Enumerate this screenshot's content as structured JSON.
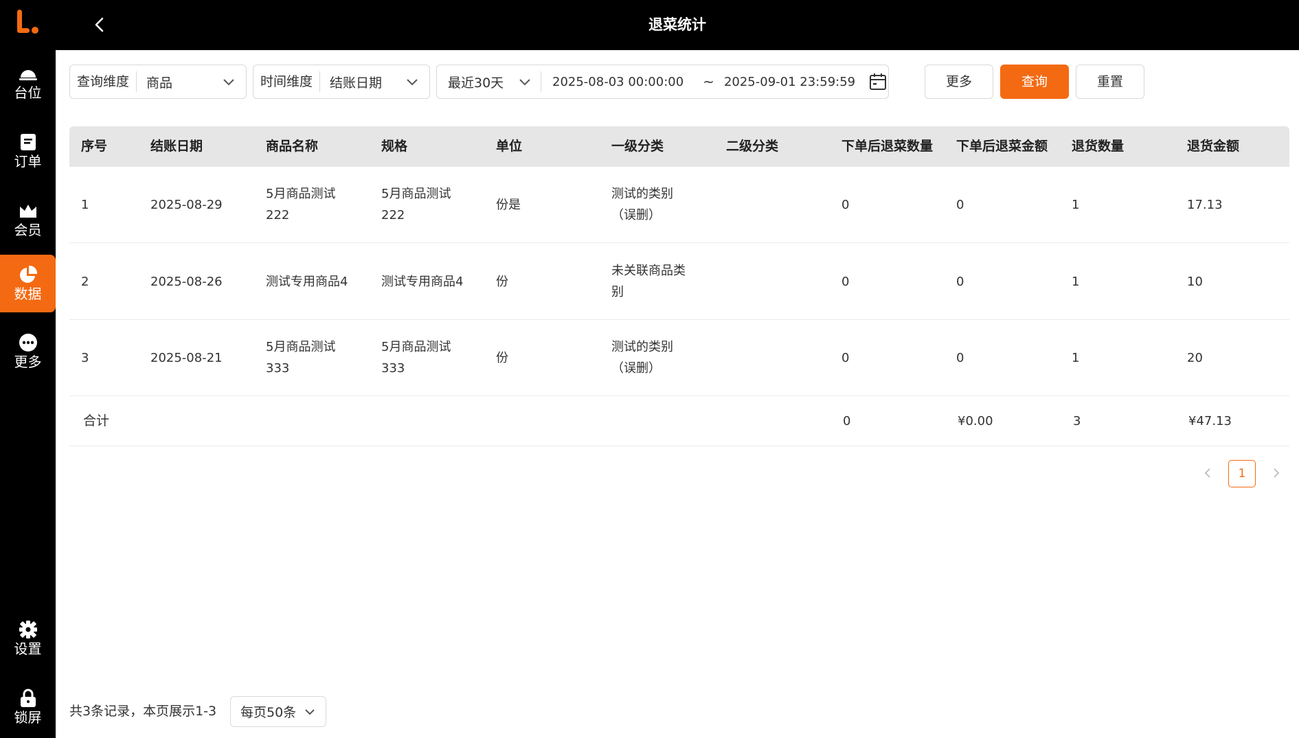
{
  "sidebar": {
    "items": [
      {
        "label": "台位",
        "icon": "table-bell-icon"
      },
      {
        "label": "订单",
        "icon": "order-doc-icon"
      },
      {
        "label": "会员",
        "icon": "crown-icon"
      },
      {
        "label": "数据",
        "icon": "pie-chart-icon",
        "active": true
      },
      {
        "label": "更多",
        "icon": "more-dots-icon"
      },
      {
        "label": "设置",
        "icon": "gear-icon"
      },
      {
        "label": "锁屏",
        "icon": "lock-icon"
      }
    ]
  },
  "header": {
    "title": "退菜统计"
  },
  "filters": {
    "query_dimension": {
      "label": "查询维度",
      "value": "商品"
    },
    "time_dimension": {
      "label": "时间维度",
      "value": "结账日期"
    },
    "range": {
      "preset": "最近30天",
      "start": "2025-08-03 00:00:00",
      "separator": "~",
      "end": "2025-09-01 23:59:59"
    }
  },
  "buttons": {
    "more": "更多",
    "query": "查询",
    "reset": "重置"
  },
  "table": {
    "columns": [
      "序号",
      "结账日期",
      "商品名称",
      "规格",
      "单位",
      "一级分类",
      "二级分类",
      "下单后退菜数量",
      "下单后退菜金额",
      "退货数量",
      "退货金额"
    ],
    "rows": [
      {
        "no": "1",
        "date": "2025-08-29",
        "name1": "5月商品测试",
        "name2": "222",
        "spec1": "5月商品测试",
        "spec2": "222",
        "unit": "份是",
        "cat1a": "测试的类别",
        "cat1b": "（误删）",
        "cat2": "",
        "ret_qty": "0",
        "ret_amt": "0",
        "refund_qty": "1",
        "refund_amt": "17.13"
      },
      {
        "no": "2",
        "date": "2025-08-26",
        "name1": "测试专用商品4",
        "name2": "",
        "spec1": "测试专用商品4",
        "spec2": "",
        "unit": "份",
        "cat1a": "未关联商品类",
        "cat1b": "别",
        "cat2": "",
        "ret_qty": "0",
        "ret_amt": "0",
        "refund_qty": "1",
        "refund_amt": "10"
      },
      {
        "no": "3",
        "date": "2025-08-21",
        "name1": "5月商品测试",
        "name2": "333",
        "spec1": "5月商品测试",
        "spec2": "333",
        "unit": "份",
        "cat1a": "测试的类别",
        "cat1b": "（误删）",
        "cat2": "",
        "ret_qty": "0",
        "ret_amt": "0",
        "refund_qty": "1",
        "refund_amt": "20"
      }
    ],
    "total": {
      "label": "合计",
      "ret_qty": "0",
      "ret_amt": "¥0.00",
      "refund_qty": "3",
      "refund_amt": "¥47.13"
    }
  },
  "pagination": {
    "current": "1",
    "summary": "共3条记录，本页展示1-3",
    "page_size": "每页50条"
  },
  "colors": {
    "accent": "#F46A12",
    "sidebar_bg": "#000000",
    "header_bg": "#e6e6e6"
  }
}
